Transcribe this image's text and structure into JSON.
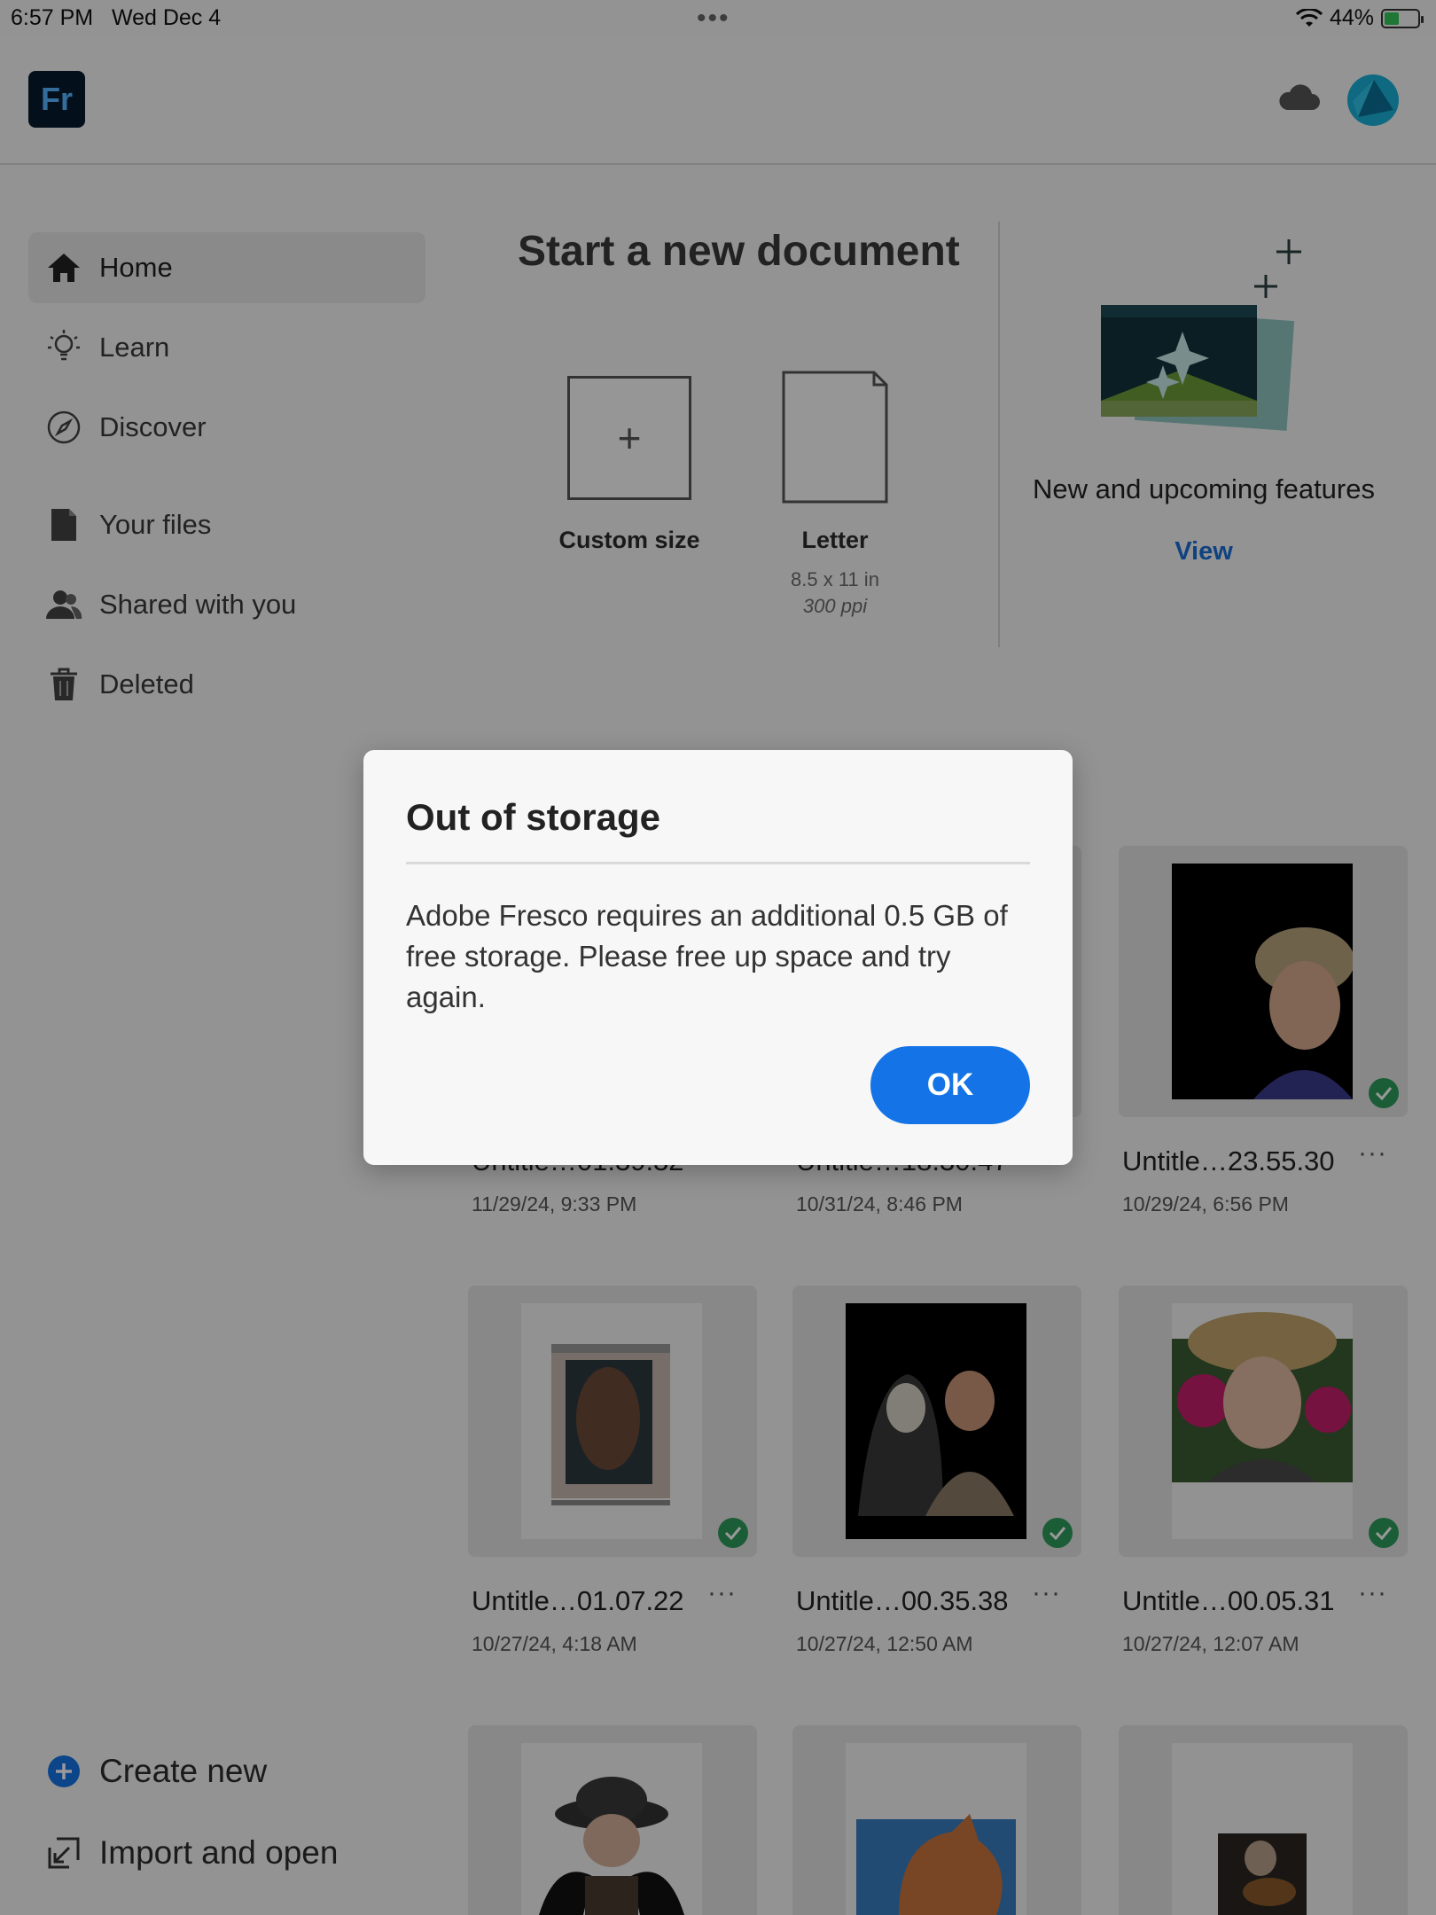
{
  "status_bar": {
    "time": "6:57 PM",
    "date": "Wed Dec 4",
    "battery": "44%",
    "battery_level": 0.44
  },
  "header": {
    "logo": "Fr"
  },
  "sidebar": {
    "items": [
      {
        "label": "Home",
        "icon": "home-icon",
        "active": true
      },
      {
        "label": "Learn",
        "icon": "lightbulb-icon"
      },
      {
        "label": "Discover",
        "icon": "compass-icon"
      },
      {
        "label": "Your files",
        "icon": "file-icon"
      },
      {
        "label": "Shared with you",
        "icon": "people-icon"
      },
      {
        "label": "Deleted",
        "icon": "trash-icon"
      }
    ],
    "bottom": [
      {
        "label": "Create new",
        "icon": "plus-circle-icon"
      },
      {
        "label": "Import and open",
        "icon": "import-icon"
      }
    ]
  },
  "new_document": {
    "title": "Start a new document",
    "custom": {
      "label": "Custom size",
      "glyph": "+"
    },
    "letter": {
      "label": "Letter",
      "size": "8.5 x 11 in",
      "ppi": "300 ppi"
    }
  },
  "features": {
    "title": "New and upcoming features",
    "link": "View"
  },
  "files": [
    {
      "name": "Untitle…01.39.32",
      "date": "11/29/24, 9:33 PM"
    },
    {
      "name": "Untitle…18.30.47",
      "date": "10/31/24, 8:46 PM"
    },
    {
      "name": "Untitle…23.55.30",
      "date": "10/29/24, 6:56 PM",
      "more": "···"
    },
    {
      "name": "Untitle…01.07.22",
      "date": "10/27/24, 4:18 AM",
      "more": "···"
    },
    {
      "name": "Untitle…00.35.38",
      "date": "10/27/24, 12:50 AM",
      "more": "···"
    },
    {
      "name": "Untitle…00.05.31",
      "date": "10/27/24, 12:07 AM",
      "more": "···"
    }
  ],
  "dialog": {
    "title": "Out of storage",
    "message": "Adobe Fresco requires an additional 0.5 GB of free storage. Please free up space and try again.",
    "ok": "OK"
  }
}
